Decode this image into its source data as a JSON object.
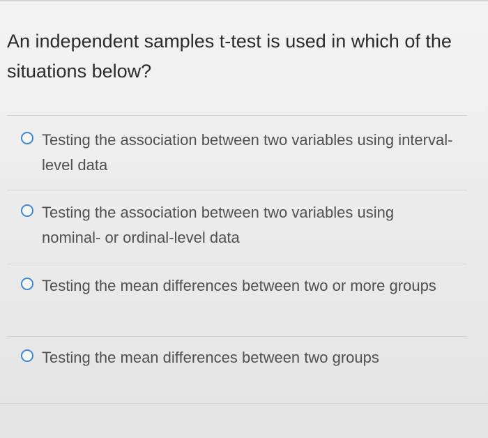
{
  "question": {
    "text": "An independent samples t-test is used in which of the situations below?"
  },
  "options": [
    {
      "label": "Testing the association between two variables using interval-level data",
      "selected": false
    },
    {
      "label": "Testing the association between two variables using nominal- or ordinal-level data",
      "selected": false
    },
    {
      "label": "Testing the mean differences between two or more groups",
      "selected": false
    },
    {
      "label": "Testing the mean differences between two groups",
      "selected": false
    }
  ],
  "colors": {
    "radio_border": "#3d88cf",
    "question_text": "#2b2b2b",
    "option_text": "#505050"
  }
}
